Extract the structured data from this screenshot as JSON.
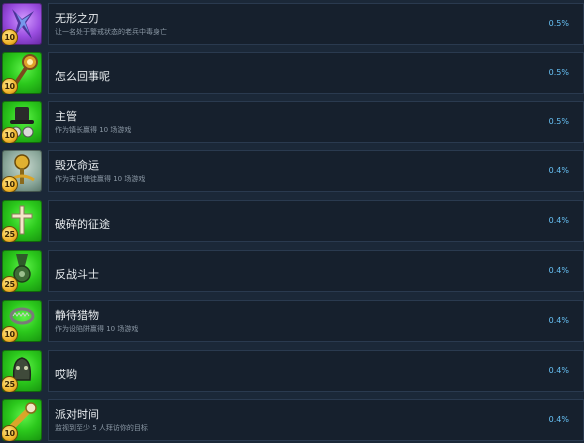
{
  "achievements": [
    {
      "title": "无形之刃",
      "description": "让一名处于警戒状态的老兵中毒身亡",
      "percent": "0.5%",
      "points": "10",
      "icon": "shuriken-icon",
      "color": "purple"
    },
    {
      "title": "怎么回事呢",
      "description": "",
      "percent": "0.5%",
      "points": "10",
      "icon": "staff-icon",
      "color": "green"
    },
    {
      "title": "主管",
      "description": "作为镇长赢得 10 场游戏",
      "percent": "0.5%",
      "points": "10",
      "icon": "top-hat-icon",
      "color": "green"
    },
    {
      "title": "毁灭命运",
      "description": "作为末日使徒赢得 10 场游戏",
      "percent": "0.4%",
      "points": "10",
      "icon": "scepter-icon",
      "color": "green"
    },
    {
      "title": "破碎的征途",
      "description": "",
      "percent": "0.4%",
      "points": "25",
      "icon": "cross-icon",
      "color": "green"
    },
    {
      "title": "反战斗士",
      "description": "",
      "percent": "0.4%",
      "points": "25",
      "icon": "medal-icon",
      "color": "green"
    },
    {
      "title": "静待猎物",
      "description": "作为设陷阱赢得 10 场游戏",
      "percent": "0.4%",
      "points": "10",
      "icon": "bear-trap-icon",
      "color": "green"
    },
    {
      "title": "哎哟",
      "description": "",
      "percent": "0.4%",
      "points": "25",
      "icon": "zombie-head-icon",
      "color": "green"
    },
    {
      "title": "派对时间",
      "description": "监视到至少 5 人拜访你的目标",
      "percent": "0.4%",
      "points": "10",
      "icon": "spyglass-icon",
      "color": "green"
    }
  ]
}
